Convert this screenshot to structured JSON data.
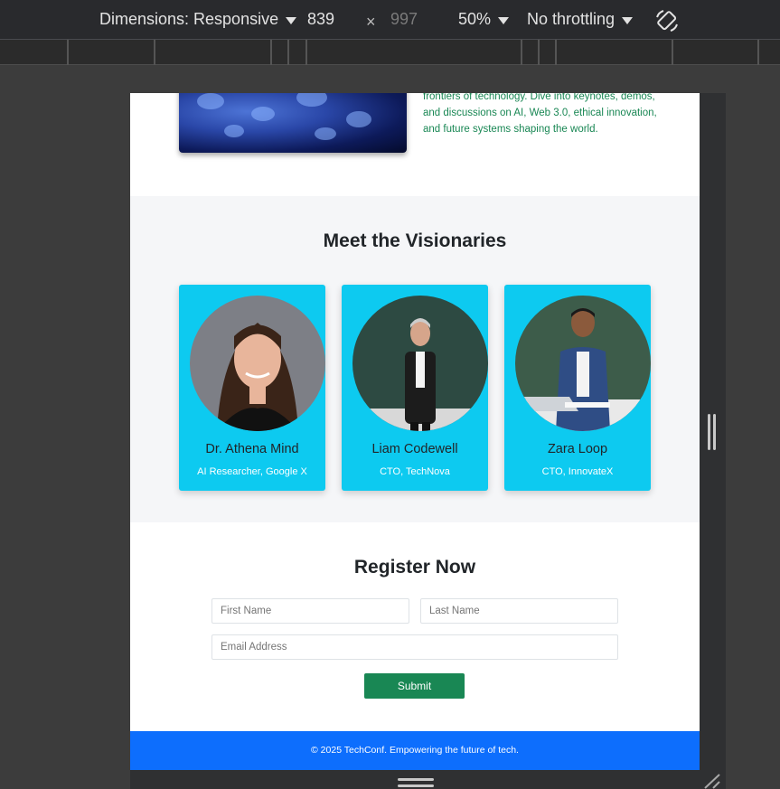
{
  "devtools": {
    "dimensions_label": "Dimensions: Responsive",
    "width": "839",
    "times": "×",
    "height": "997",
    "zoom": "50%",
    "throttling": "No throttling"
  },
  "about": {
    "text": "frontiers of technology. Dive into keynotes, demos, and discussions on AI, Web 3.0, ethical innovation, and future systems shaping the world."
  },
  "speakers": {
    "title": "Meet the Visionaries",
    "cards": [
      {
        "name": "Dr. Athena Mind",
        "role": "AI Researcher, Google X"
      },
      {
        "name": "Liam Codewell",
        "role": "CTO, TechNova"
      },
      {
        "name": "Zara Loop",
        "role": "CTO, InnovateX"
      }
    ]
  },
  "register": {
    "title": "Register Now",
    "first_name_placeholder": "First Name",
    "last_name_placeholder": "Last Name",
    "email_placeholder": "Email Address",
    "submit_label": "Submit"
  },
  "footer": {
    "text": "© 2025 TechConf. Empowering the future of tech."
  },
  "colors": {
    "accent_green": "#198754",
    "card_cyan": "#0dcaf0",
    "footer_blue": "#0d6efd"
  }
}
